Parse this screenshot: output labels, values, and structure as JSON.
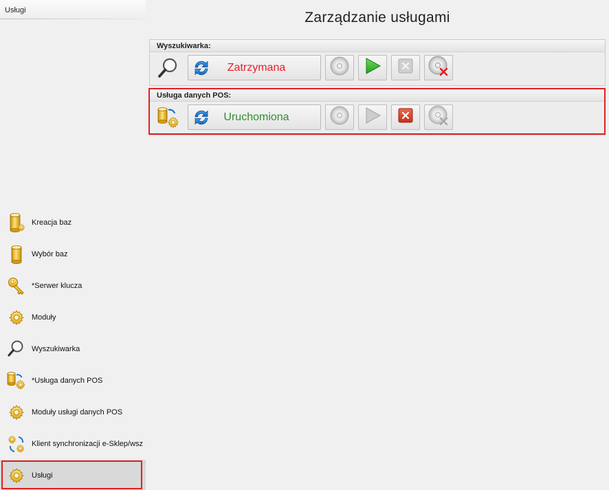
{
  "window": {
    "section_title": "Usługi"
  },
  "sidebar": {
    "items": [
      {
        "label": "Kreacja baz",
        "icon": "database-gear-icon"
      },
      {
        "label": "Wybór baz",
        "icon": "database-icon"
      },
      {
        "label": "*Serwer klucza",
        "icon": "key-icon"
      },
      {
        "label": "Moduły",
        "icon": "gear-icon"
      },
      {
        "label": "Wyszukiwarka",
        "icon": "magnifier-icon"
      },
      {
        "label": "*Usługa danych POS",
        "icon": "database-sync-gear-icon"
      },
      {
        "label": "Moduły usługi danych POS",
        "icon": "gear-icon"
      },
      {
        "label": "Klient synchronizacji e-Sklep/wszystkie",
        "icon": "sync-gears-icon"
      },
      {
        "label": "Usługi",
        "icon": "gear-icon",
        "active": true
      }
    ]
  },
  "main": {
    "title": "Zarządzanie usługami",
    "services": [
      {
        "header": "Wyszukiwarka:",
        "status": "Zatrzymana",
        "status_color": "#e8202a",
        "icon": "magnifier-icon",
        "buttons": [
          "install-icon-disabled",
          "start-icon-enabled",
          "stop-icon-disabled",
          "uninstall-icon-enabled"
        ]
      },
      {
        "header": "Usługa danych POS:",
        "status": "Uruchomiona",
        "status_color": "#2f8f2f",
        "icon": "database-sync-gear-icon",
        "buttons": [
          "install-icon-disabled",
          "start-icon-disabled",
          "stop-icon-enabled",
          "uninstall-icon-disabled"
        ],
        "highlighted": true
      }
    ]
  },
  "colors": {
    "highlight": "#e02020",
    "stopped": "#e8202a",
    "running": "#2f8f2f",
    "start_green": "#3cb43c",
    "stop_red": "#d9412b"
  }
}
